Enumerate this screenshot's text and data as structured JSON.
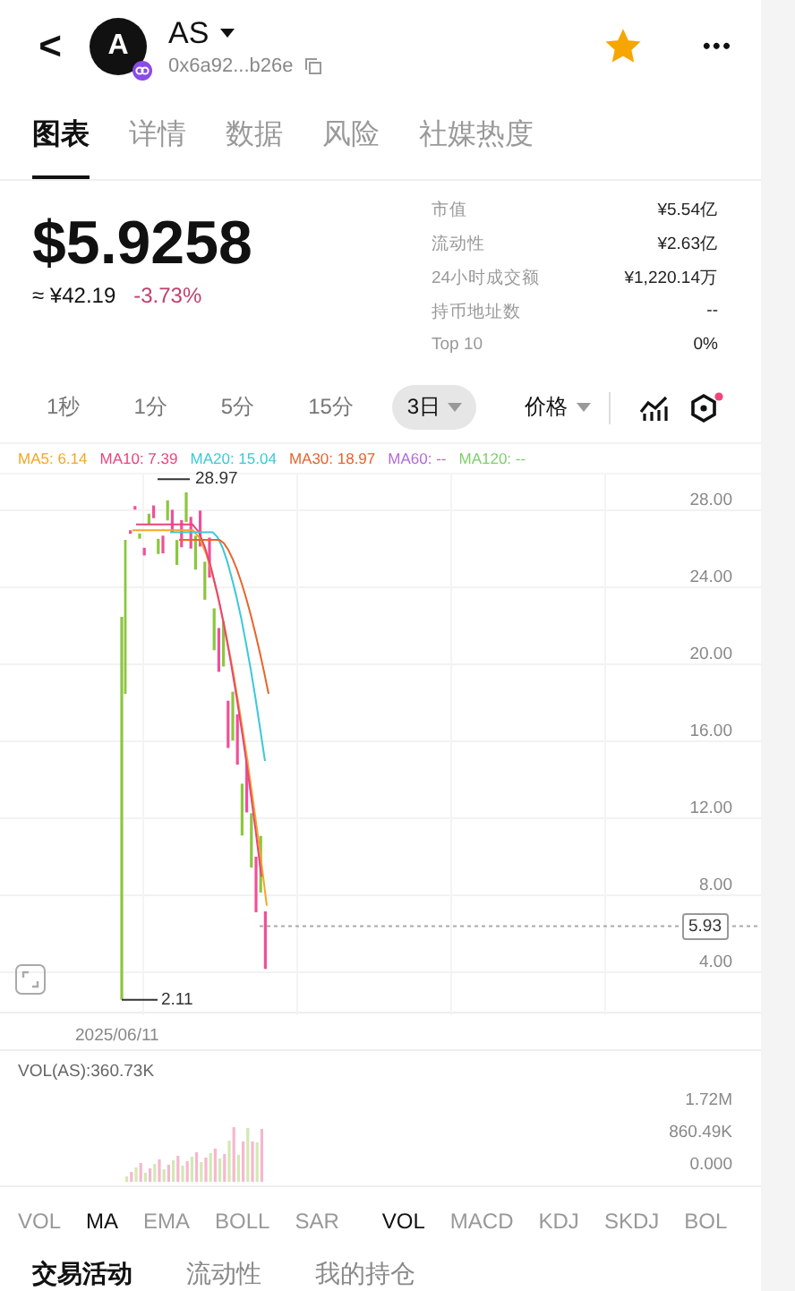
{
  "header": {
    "back": "<",
    "avatar_letter": "A",
    "symbol": "AS",
    "address": "0x6a92...b26e",
    "favorite": true,
    "more": "•••"
  },
  "tabs": [
    {
      "label": "图表",
      "selected": true
    },
    {
      "label": "详情",
      "selected": false
    },
    {
      "label": "数据",
      "selected": false
    },
    {
      "label": "风险",
      "selected": false
    },
    {
      "label": "社媒热度",
      "selected": false
    }
  ],
  "price": {
    "value": "$5.9258",
    "approx": "≈ ¥42.19",
    "change": "-3.73%"
  },
  "stats": [
    {
      "label": "市值",
      "value": "¥5.54亿"
    },
    {
      "label": "流动性",
      "value": "¥2.63亿"
    },
    {
      "label": "24小时成交额",
      "value": "¥1,220.14万"
    },
    {
      "label": "持币地址数",
      "value": "--"
    },
    {
      "label": "Top 10",
      "value": "0%"
    }
  ],
  "timeframes": [
    {
      "label": "1秒",
      "selected": false
    },
    {
      "label": "1分",
      "selected": false
    },
    {
      "label": "5分",
      "selected": false
    },
    {
      "label": "15分",
      "selected": false
    },
    {
      "label": "3日",
      "selected": true
    }
  ],
  "price_type": "价格",
  "ma_legend": [
    {
      "label": "MA5: 6.14",
      "color": "#f5a623"
    },
    {
      "label": "MA10: 7.39",
      "color": "#e8457c"
    },
    {
      "label": "MA20: 15.04",
      "color": "#3cc8d8"
    },
    {
      "label": "MA30: 18.97",
      "color": "#e8642c"
    },
    {
      "label": "MA60: --",
      "color": "#b46ad8"
    },
    {
      "label": "MA120: --",
      "color": "#7ccf6a"
    }
  ],
  "y_axis": [
    "28.00",
    "24.00",
    "20.00",
    "16.00",
    "12.00",
    "8.00",
    "4.00"
  ],
  "high_label": "28.97",
  "low_label": "2.11",
  "current_price": "5.93",
  "date": "2025/06/11",
  "volume": {
    "label": "VOL(AS):360.73K",
    "axis": [
      "1.72M",
      "860.49K",
      "0.000"
    ]
  },
  "main_indicators": [
    {
      "label": "VOL",
      "selected": false
    },
    {
      "label": "MA",
      "selected": true
    },
    {
      "label": "EMA",
      "selected": false
    },
    {
      "label": "BOLL",
      "selected": false
    },
    {
      "label": "SAR",
      "selected": false
    }
  ],
  "sub_indicators": [
    {
      "label": "VOL",
      "selected": true
    },
    {
      "label": "MACD",
      "selected": false
    },
    {
      "label": "KDJ",
      "selected": false
    },
    {
      "label": "SKDJ",
      "selected": false
    },
    {
      "label": "BOL",
      "selected": false
    }
  ],
  "bottom_tabs": [
    {
      "label": "交易活动",
      "selected": true
    },
    {
      "label": "流动性",
      "selected": false
    },
    {
      "label": "我的持仓",
      "selected": false
    }
  ]
}
